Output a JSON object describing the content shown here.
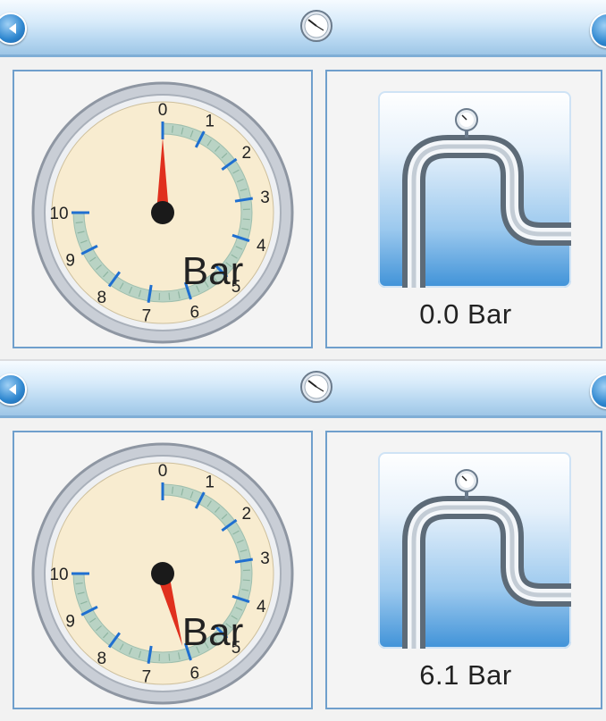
{
  "screens": [
    {
      "id": "top",
      "pressure_value": 0.0,
      "pressure_readout": "0.0 Bar",
      "gauge": {
        "unit_label": "Bar",
        "scale_min": 0,
        "scale_max": 10,
        "tick_labels": [
          "0",
          "1",
          "2",
          "3",
          "4",
          "5",
          "6",
          "7",
          "8",
          "9",
          "10"
        ]
      }
    },
    {
      "id": "bottom",
      "pressure_value": 6.1,
      "pressure_readout": "6.1 Bar",
      "gauge": {
        "unit_label": "Bar",
        "scale_min": 0,
        "scale_max": 10,
        "tick_labels": [
          "0",
          "1",
          "2",
          "3",
          "4",
          "5",
          "6",
          "7",
          "8",
          "9",
          "10"
        ]
      }
    }
  ],
  "icons": {
    "back": "arrow-left-icon",
    "forward": "arrow-right-icon",
    "title": "pressure-gauge-icon",
    "pipe": "pipe-with-gauge-icon"
  },
  "colors": {
    "titlebar": "#b5d6f0",
    "panel_border": "#6f9fcc",
    "needle": "#e0301e",
    "tick": "#1f6fd0",
    "dial_face": "#f8ecd0"
  }
}
